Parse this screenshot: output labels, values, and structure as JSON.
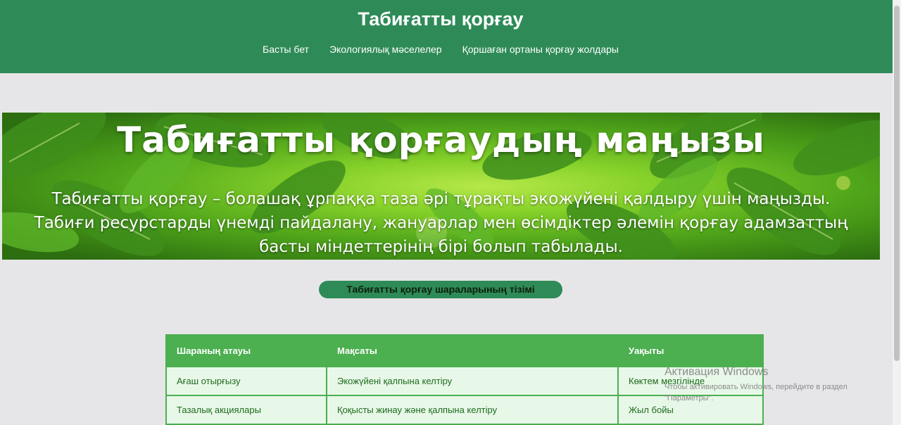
{
  "header": {
    "title": "Табиғатты қорғау",
    "nav": [
      "Басты бет",
      "Экологиялық мәселелер",
      "Қоршаған ортаны қорғау жолдары"
    ]
  },
  "hero": {
    "title": "Табиғатты қорғаудың маңызы",
    "text": "Табиғатты қорғау – болашақ ұрпаққа таза әрі тұрақты экожүйені қалдыру үшін маңызды. Табиғи ресурстарды үнемді пайдалану, жануарлар мен өсімдіктер әлемін қорғау адамзаттың басты міндеттерінің бірі болып табылады."
  },
  "list_button": "Табиғатты қорғау шараларының тізімі",
  "table": {
    "headers": [
      "Шараның атауы",
      "Мақсаты",
      "Уақыты"
    ],
    "rows": [
      [
        "Ағаш отырғызу",
        "Экожүйені қалпына келтіру",
        "Көктем мезгілінде"
      ],
      [
        "Тазалық акциялары",
        "Қоқысты жинау және қалпына келтіру",
        "Жыл бойы"
      ]
    ]
  },
  "watermark": {
    "title": "Активация Windows",
    "subtitle": "Чтобы активировать Windows, перейдите в раздел \"Параметры\"."
  },
  "colors": {
    "header_bg": "#2e8b57",
    "table_header_bg": "#4caf50",
    "table_cell_bg": "#e8f8e8",
    "page_bg": "#e6e6e8"
  }
}
